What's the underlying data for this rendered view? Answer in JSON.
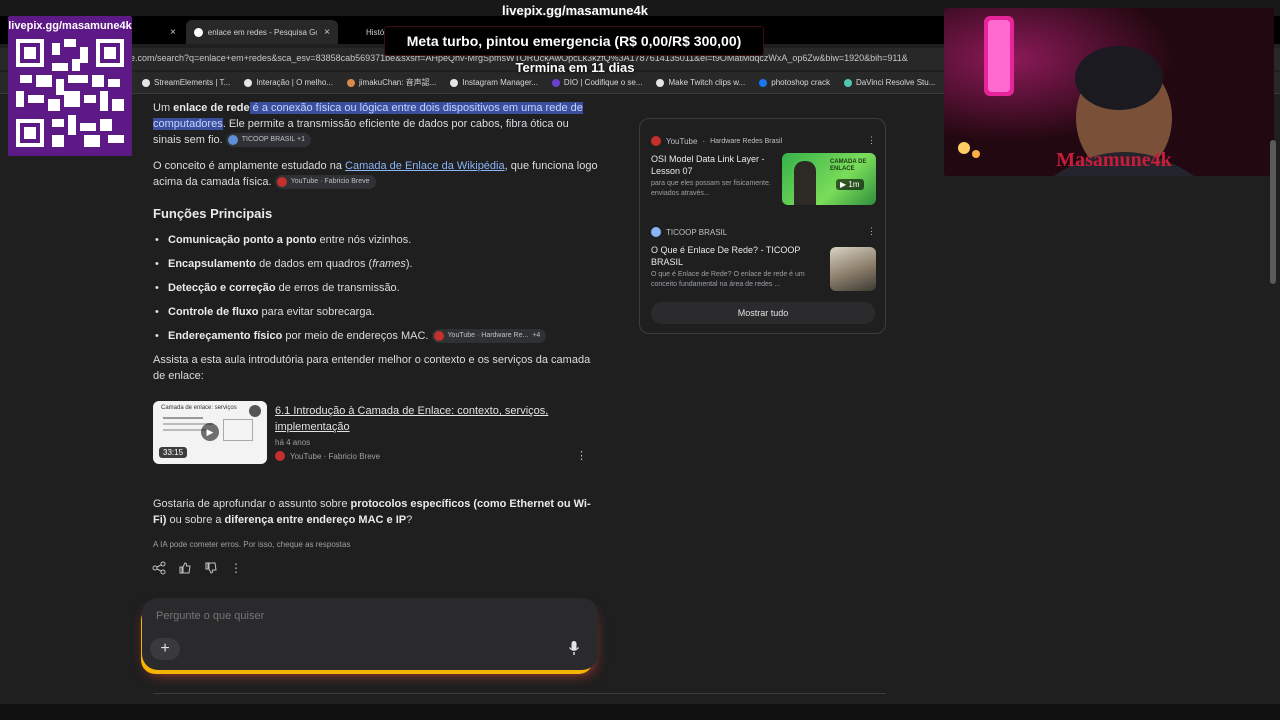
{
  "overlay": {
    "stream_url": "livepix.gg/masamune4k",
    "qr_title": "livepix.gg/masamune4k",
    "goal_text": "Meta turbo, pintou emergencia (R$ 0,00/R$ 300,00)",
    "goal_sub": "Termina em 11 dias",
    "webcam_logo": "Masamune4k"
  },
  "browser": {
    "tabs": [
      {
        "label": "enlace em redes - Pesquisa Go",
        "close": "×"
      },
      {
        "label": "Histó",
        "close": ""
      }
    ],
    "first_tab_close": "×",
    "address": "e.com/search?q=enlace+em+redes&sca_esv=83858cab569371be&sxsrf=AHpeQhv-MrgSpmsWTORUckAwOpcLk3kzfQ%3A1787614135011&ei=t9OMatMdqczWxA_op6Zw&biw=1920&bih=911&",
    "bookmarks": [
      {
        "label": "StreamElements | T...",
        "color": "#e6e6e6"
      },
      {
        "label": "Interação | O melho...",
        "color": "#e6e6e6"
      },
      {
        "label": "jimakuChan: 音声認...",
        "color": "#d98a4a"
      },
      {
        "label": "Instagram Manager...",
        "color": "#e6e6e6"
      },
      {
        "label": "DIO | Codifique o se...",
        "color": "#6b3fd1"
      },
      {
        "label": "Make Twitch clips w...",
        "color": "#e6e6e6"
      },
      {
        "label": "photoshop crack",
        "color": "#1877f2"
      },
      {
        "label": "DaVinci Resolve Stu...",
        "color": "#4fc7b0"
      }
    ]
  },
  "answer": {
    "p1_pre": "Um ",
    "p1_bold": "enlace de rede",
    "p1_hl": " é a conexão física ou lógica entre dois dispositivos em uma rede de computadores",
    "p1_post": ". Ele permite a transmissão eficiente de dados por cabos, fibra ótica ou sinais sem fio.",
    "p1_chip": "TICOOP BRASIL +1",
    "p2_pre": "O conceito é amplamente estudado na ",
    "p2_link": "Camada de Enlace da Wikipédia",
    "p2_post": ", que funciona logo acima da camada física.",
    "p2_chip": "YouTube · Fabricio Breve",
    "section_title": "Funções Principais",
    "functions": [
      {
        "bold": "Comunicação ponto a ponto",
        "text": " entre nós vizinhos."
      },
      {
        "bold": "Encapsulamento",
        "text": " de dados em quadros (",
        "italic": "frames",
        "after": ")."
      },
      {
        "bold": "Detecção e correção",
        "text": " de erros de transmissão."
      },
      {
        "bold": "Controle de fluxo",
        "text": " para evitar sobrecarga."
      },
      {
        "bold": "Endereçamento físico",
        "text": " por meio de endereços MAC.",
        "chip": "YouTube · Hardware Re...",
        "chip_extra": "+4"
      }
    ],
    "intro": "Assista a esta aula introdutória para entender melhor o contexto e os serviços da camada de enlace:",
    "video": {
      "title": "6.1 Introdução à Camada de Enlace: contexto, serviços, implementação",
      "age": "há 4 anos",
      "source": "YouTube · Fabricio Breve",
      "duration": "33:15",
      "thumb_caption": "Camada de enlace: serviços"
    },
    "followup_pre": "Gostaria de aprofundar o assunto sobre ",
    "followup_b1": "protocolos específicos (como Ethernet ou Wi-Fi)",
    "followup_mid": " ou sobre a ",
    "followup_b2": "diferença entre endereço MAC e IP",
    "followup_post": "?",
    "disclaimer": "A IA pode cometer erros. Por isso, cheque as respostas"
  },
  "ask": {
    "placeholder": "Pergunte o que quiser",
    "plus": "+"
  },
  "sources": [
    {
      "site": "YouTube",
      "channel": "Hardware Redes Brasil",
      "title": "OSI Model Data Link Layer - Lesson 07",
      "snippet": "para que eles possam ser fisicamente. enviados através...",
      "duration": "1m",
      "thumb_text": "CAMADA DE ENLACE"
    },
    {
      "site": "TICOOP BRASIL",
      "channel": "",
      "title": "O Que é Enlace De Rede? - TICOOP BRASIL",
      "snippet": "O que é Enlace de Rede? O enlace de rede é um conceito fundamental na área de redes ..."
    }
  ],
  "show_all": "Mostrar tudo",
  "icons": {
    "kebab": "⋮",
    "share": "share-icon",
    "thumbs_up": "thumbs-up-icon",
    "thumbs_down": "thumbs-down-icon"
  }
}
